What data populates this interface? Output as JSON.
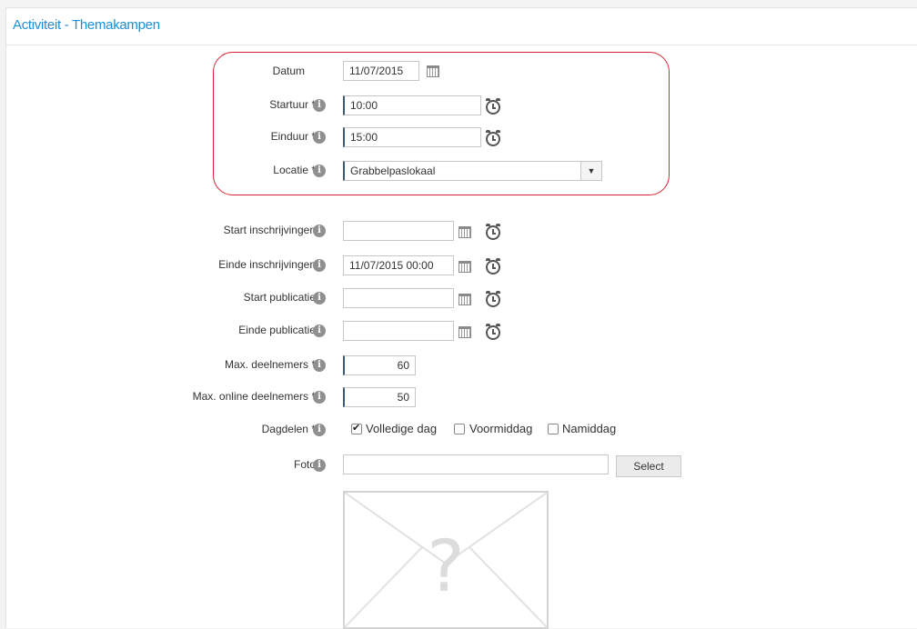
{
  "page": {
    "title": "Activiteit - Themakampen"
  },
  "fields": {
    "datum": {
      "label": "Datum",
      "value": "11/07/2015"
    },
    "startuur": {
      "label": "Startuur *",
      "value": "10:00"
    },
    "einduur": {
      "label": "Einduur *",
      "value": "15:00"
    },
    "locatie": {
      "label": "Locatie *",
      "value": "Grabbelpaslokaal"
    },
    "start_inschrijvingen": {
      "label": "Start inschrijvingen",
      "value": ""
    },
    "einde_inschrijvingen": {
      "label": "Einde inschrijvingen",
      "value": "11/07/2015 00:00"
    },
    "start_publicatie": {
      "label": "Start publicatie",
      "value": ""
    },
    "einde_publicatie": {
      "label": "Einde publicatie",
      "value": ""
    },
    "max_deelnemers": {
      "label": "Max. deelnemers *",
      "value": "60"
    },
    "max_online_deelnemers": {
      "label": "Max. online deelnemers *",
      "value": "50"
    },
    "dagdelen": {
      "label": "Dagdelen *",
      "options": [
        {
          "label": "Volledige dag",
          "checked": true
        },
        {
          "label": "Voormiddag",
          "checked": false
        },
        {
          "label": "Namiddag",
          "checked": false
        }
      ]
    },
    "foto": {
      "label": "Foto",
      "value": "",
      "button_label": "Select"
    }
  },
  "icons": {
    "info": "info-icon",
    "calendar": "calendar-icon",
    "clock": "alarm-clock-icon",
    "dropdown": "chevron-down-icon",
    "image_placeholder": "image-placeholder-icon"
  },
  "colors": {
    "title": "#1f8fd4",
    "highlight_border": "#d9252f",
    "info_icon": "#8f8f8f"
  },
  "glyphs": {
    "info": "i",
    "dropdown": "▼",
    "placeholder": "?"
  }
}
